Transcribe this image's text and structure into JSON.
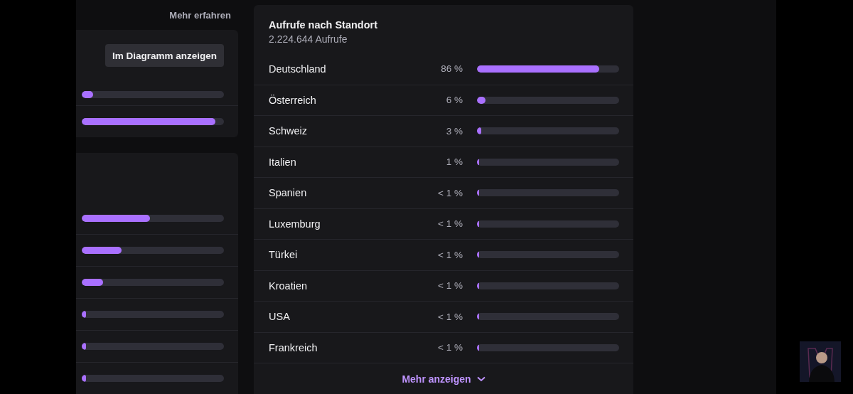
{
  "side_panel": {
    "link": "Mehr erfahren",
    "card_1": {
      "button": "Im Diagramm anzeigen",
      "bars": [
        {
          "level": 0.08
        },
        {
          "level": 0.94
        }
      ]
    },
    "card_2": {
      "bars": [
        {
          "level": 0.48
        },
        {
          "level": 0.28
        },
        {
          "level": 0.15
        },
        {
          "level": 0.03
        },
        {
          "level": 0.03
        },
        {
          "level": 0.03
        }
      ]
    }
  },
  "location_card": {
    "title": "Aufrufe nach Standort",
    "subtitle": "2.224.644 Aufrufe",
    "rows": [
      {
        "country": "Deutschland",
        "percent": "86 %",
        "level": 0.86
      },
      {
        "country": "Österreich",
        "percent": "6 %",
        "level": 0.06
      },
      {
        "country": "Schweiz",
        "percent": "3 %",
        "level": 0.03
      },
      {
        "country": "Italien",
        "percent": "1 %",
        "level": 0.01
      },
      {
        "country": "Spanien",
        "percent": "< 1 %",
        "level": 0.005
      },
      {
        "country": "Luxemburg",
        "percent": "< 1 %",
        "level": 0.005
      },
      {
        "country": "Türkei",
        "percent": "< 1 %",
        "level": 0.005
      },
      {
        "country": "Kroatien",
        "percent": "< 1 %",
        "level": 0.005
      },
      {
        "country": "USA",
        "percent": "< 1 %",
        "level": 0.005
      },
      {
        "country": "Frankreich",
        "percent": "< 1 %",
        "level": 0.005
      }
    ],
    "more_button": "Mehr anzeigen"
  }
}
